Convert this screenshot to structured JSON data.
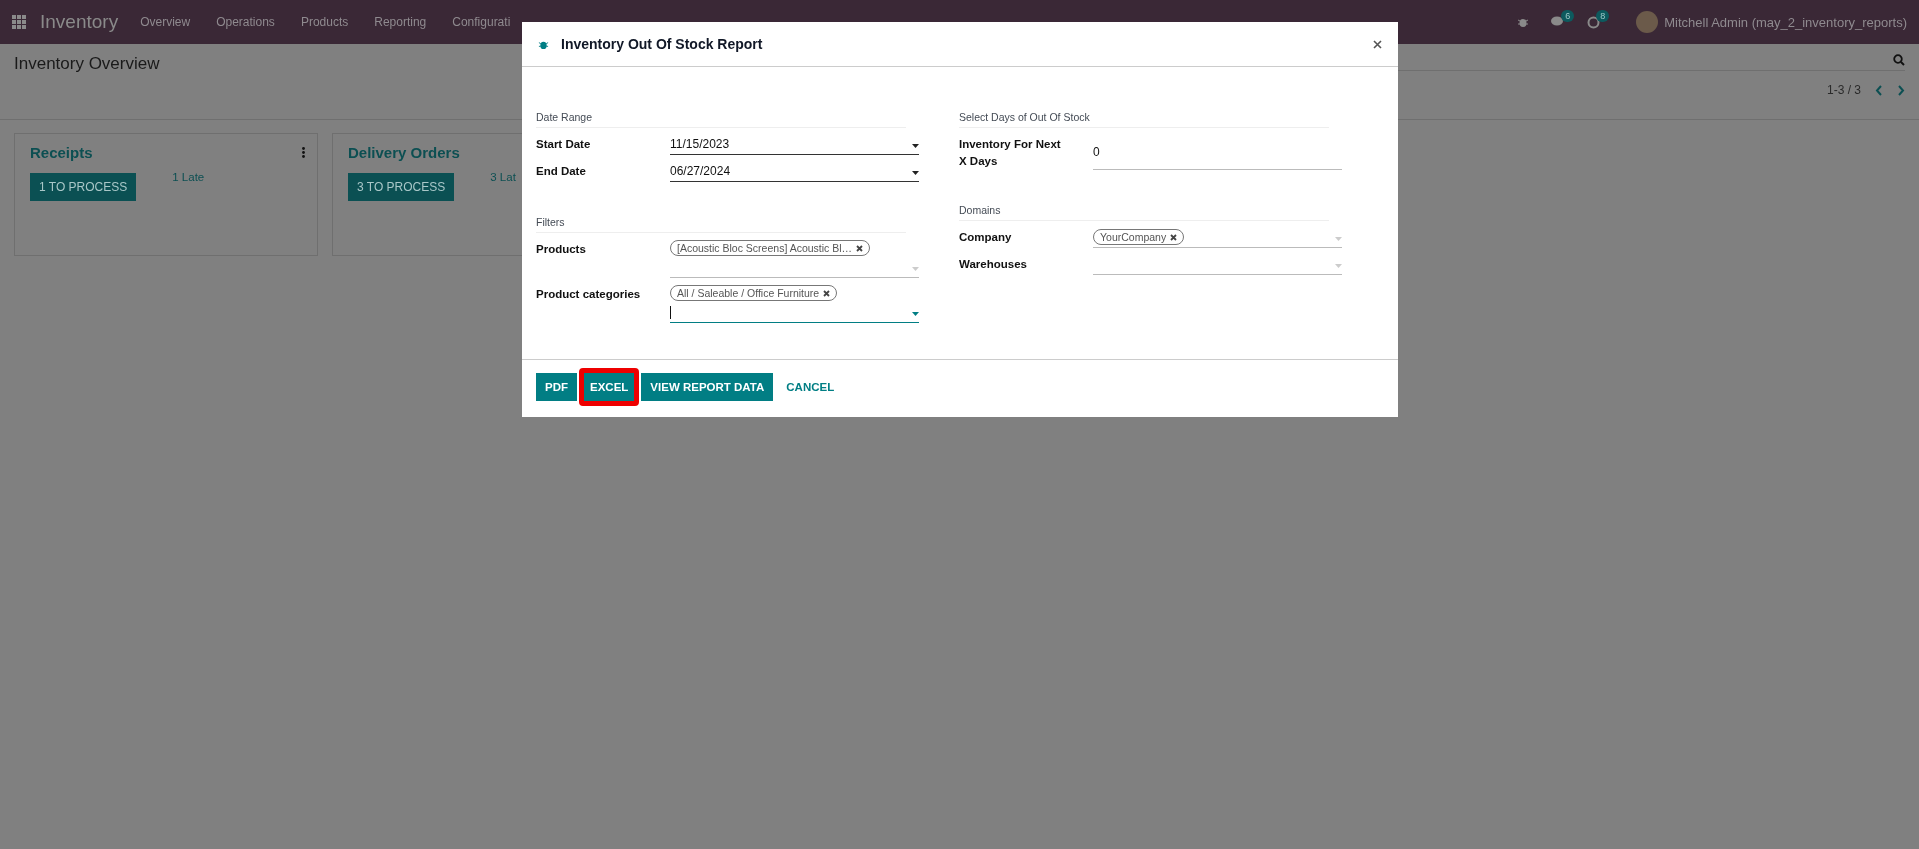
{
  "navbar": {
    "app_name": "Inventory",
    "menu": [
      "Overview",
      "Operations",
      "Products",
      "Reporting",
      "Configurati"
    ],
    "messages_count": "6",
    "activities_count": "8",
    "user": "Mitchell Admin (may_2_inventory_reports)"
  },
  "page": {
    "title": "Inventory Overview",
    "pager": "1-3 / 3"
  },
  "cards": [
    {
      "title": "Receipts",
      "button": "1 TO PROCESS",
      "late": "1 Late",
      "menu": true
    },
    {
      "title": "Delivery Orders",
      "button": "3 TO PROCESS",
      "late": "3 Lat",
      "menu": false
    }
  ],
  "dialog": {
    "title": "Inventory Out Of Stock Report",
    "left_sections": [
      {
        "heading": "Date Range",
        "fields": [
          {
            "kind": "date",
            "label": "Start Date",
            "value": "11/15/2023"
          },
          {
            "kind": "date",
            "label": "End Date",
            "value": "06/27/2024"
          }
        ]
      },
      {
        "heading": "Filters",
        "fields": [
          {
            "kind": "tags",
            "label": "Products",
            "tags": [
              "[Acoustic Bloc Screens] Acoustic Bl…"
            ],
            "focused": false
          },
          {
            "kind": "tags",
            "label": "Product categories",
            "tags": [
              "All / Saleable / Office Furniture"
            ],
            "focused": true
          }
        ]
      }
    ],
    "right_sections": [
      {
        "heading": "Select Days of Out Of Stock",
        "fields": [
          {
            "kind": "number",
            "label": "Inventory For Next X Days",
            "value": "0"
          }
        ]
      },
      {
        "heading": "Domains",
        "fields": [
          {
            "kind": "tags",
            "label": "Company",
            "tags": [
              "YourCompany"
            ],
            "focused": false
          },
          {
            "kind": "tags",
            "label": "Warehouses",
            "focused": false
          }
        ]
      }
    ],
    "buttons": [
      {
        "label": "PDF",
        "kind": "primary",
        "highlighted": false
      },
      {
        "label": "EXCEL",
        "kind": "primary",
        "highlighted": true
      },
      {
        "label": "VIEW REPORT DATA",
        "kind": "primary",
        "highlighted": false
      },
      {
        "label": "CANCEL",
        "kind": "link",
        "highlighted": false
      }
    ]
  }
}
